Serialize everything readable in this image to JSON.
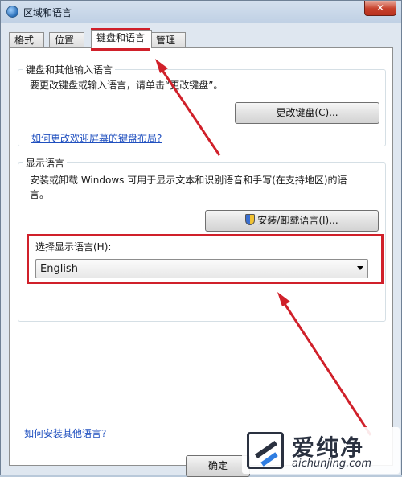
{
  "window": {
    "title": "区域和语言",
    "close_glyph": "✕"
  },
  "tabs": [
    {
      "label": "格式"
    },
    {
      "label": "位置"
    },
    {
      "label": "键盘和语言"
    },
    {
      "label": "管理"
    }
  ],
  "keyboards": {
    "group_title": "键盘和其他输入语言",
    "description": "要更改键盘或输入语言，请单击“更改键盘”。",
    "button_label": "更改键盘(C)...",
    "welcome_link": "如何更改欢迎屏幕的键盘布局?"
  },
  "display_language": {
    "group_title": "显示语言",
    "description_line1": "安装或卸载 Windows 可用于显示文本和识别语音和手写(在支持地区)的语",
    "description_line2": "言。",
    "install_button_label": "安装/卸载语言(I)...",
    "select_label": "选择显示语言(H):",
    "selected_value": "English"
  },
  "footer": {
    "install_link": "如何安装其他语言?",
    "ok_label": "确定"
  },
  "watermark": {
    "name": "爱纯净",
    "domain": "aichunjing.com"
  },
  "icons": {
    "title": "globe-icon",
    "uac": "uac-shield-icon",
    "dropdown": "chevron-down-icon"
  },
  "colors": {
    "highlight": "#d0202a",
    "link": "#1f4fbf"
  }
}
